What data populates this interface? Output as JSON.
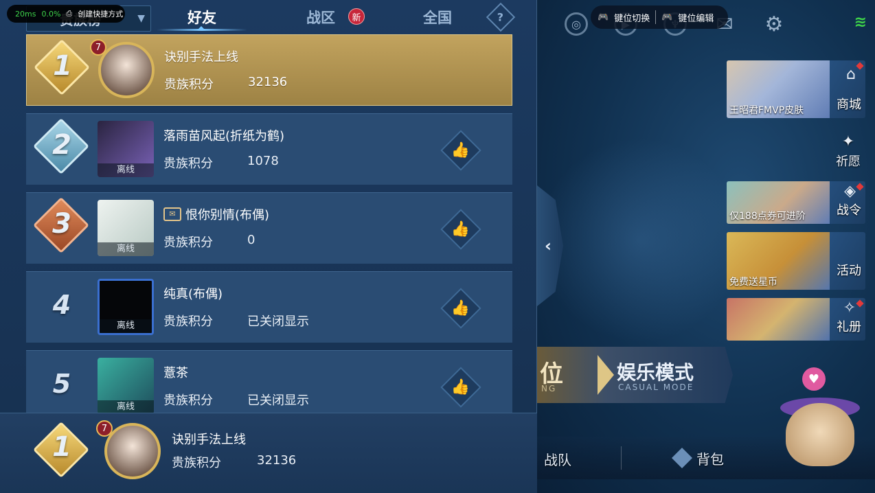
{
  "overlay": {
    "latency": "20ms",
    "percent": "0.0%",
    "shortcut_label": "创建快捷方式"
  },
  "tabs": {
    "dropdown_label": "贵族榜",
    "friends": "好友",
    "region": "战区",
    "region_badge": "新",
    "national": "全国",
    "help_symbol": "?"
  },
  "leaderboard": {
    "score_label": "贵族积分",
    "offline_label": "离线",
    "rows": [
      {
        "rank": "1",
        "name": "诀别手法上线",
        "score": "32136",
        "level": "7"
      },
      {
        "rank": "2",
        "name": "落雨苗风起(折纸为鹤)",
        "score": "1078"
      },
      {
        "rank": "3",
        "name": "恨你别情(布偶)",
        "score": "0"
      },
      {
        "rank": "4",
        "name": "纯真(布偶)",
        "score": "已关闭显示"
      },
      {
        "rank": "5",
        "name": "薏茶",
        "score": "已关闭显示"
      }
    ]
  },
  "self": {
    "rank": "1",
    "name": "诀别手法上线",
    "score": "32136",
    "level": "7"
  },
  "keytips": {
    "switch": "键位切换",
    "edit": "键位编辑"
  },
  "side": {
    "shop_caption": "王昭君FMVP皮肤",
    "shop_tag": "商城",
    "wish_tag": "祈愿",
    "pass_caption": "仅188点券可进阶",
    "pass_tag": "战令",
    "event_caption": "免费送星币",
    "event_tag": "活动",
    "gift_tag": "礼册"
  },
  "mode": {
    "rank_partial": "位",
    "rank_sub": "NG",
    "title": "娱乐模式",
    "sub": "CASUAL MODE"
  },
  "bottom": {
    "team": "战队",
    "bag": "背包"
  }
}
